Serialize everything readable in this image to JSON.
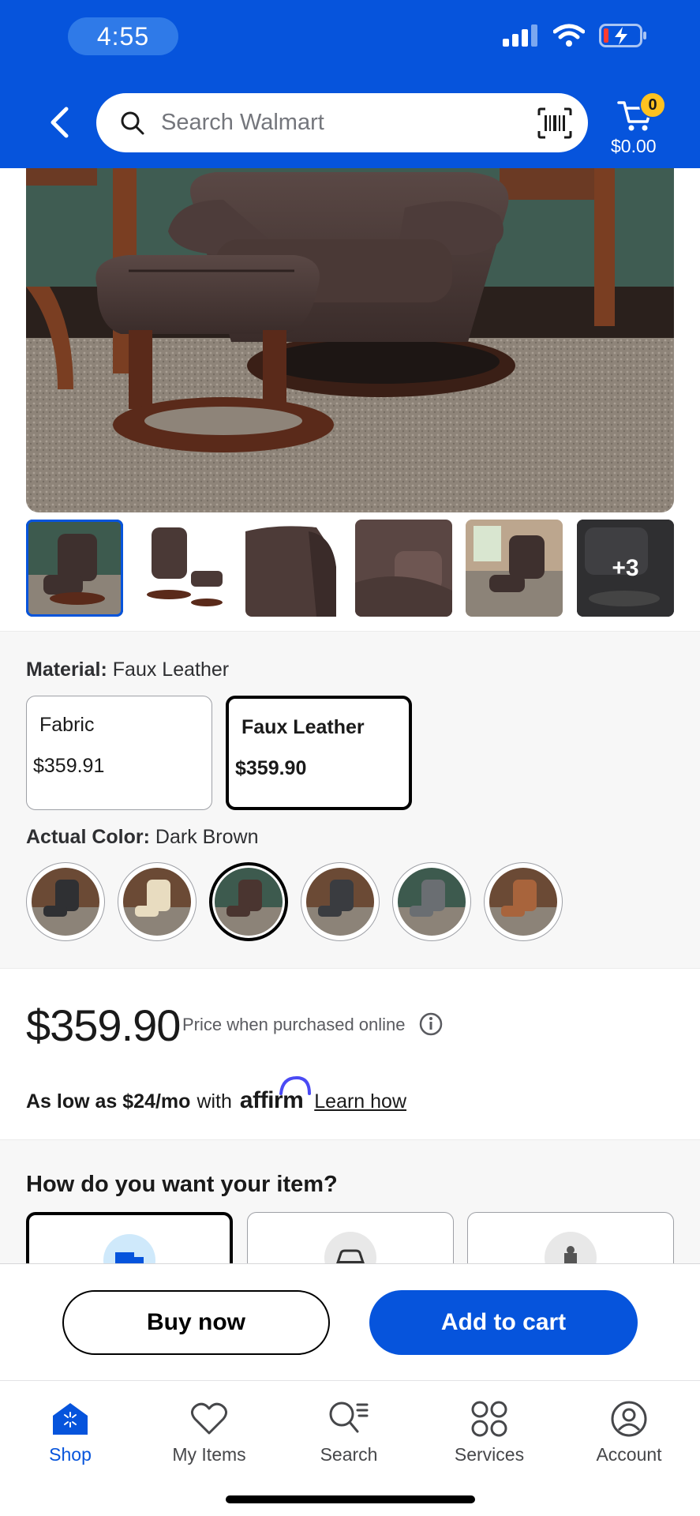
{
  "status_bar": {
    "time": "4:55"
  },
  "header": {
    "search_placeholder": "Search Walmart",
    "cart_count": "0",
    "cart_total": "$0.00"
  },
  "gallery": {
    "more_count": "+3"
  },
  "material": {
    "label": "Material:",
    "value": "Faux Leather",
    "options": [
      {
        "name": "Fabric",
        "price": "$359.91"
      },
      {
        "name": "Faux Leather",
        "price": "$359.90"
      }
    ]
  },
  "color": {
    "label": "Actual Color:",
    "value": "Dark Brown",
    "swatch_colors": [
      "#2f3033",
      "#e8dcc0",
      "#4a3530",
      "#3a3c40",
      "#6a6e72",
      "#a8643c"
    ]
  },
  "pricing": {
    "price": "$359.90",
    "note": "Price when purchased online",
    "as_low_as": "As low as $24/mo",
    "with": "with",
    "affirm": "affirm",
    "learn_how": "Learn how"
  },
  "fulfillment": {
    "title": "How do you want your item?"
  },
  "actions": {
    "buy_now": "Buy now",
    "add_to_cart": "Add to cart"
  },
  "tabs": [
    {
      "label": "Shop"
    },
    {
      "label": "My Items"
    },
    {
      "label": "Search"
    },
    {
      "label": "Services"
    },
    {
      "label": "Account"
    }
  ],
  "colors": {
    "brand_blue": "#0654dc",
    "spark_yellow": "#ffc220"
  }
}
